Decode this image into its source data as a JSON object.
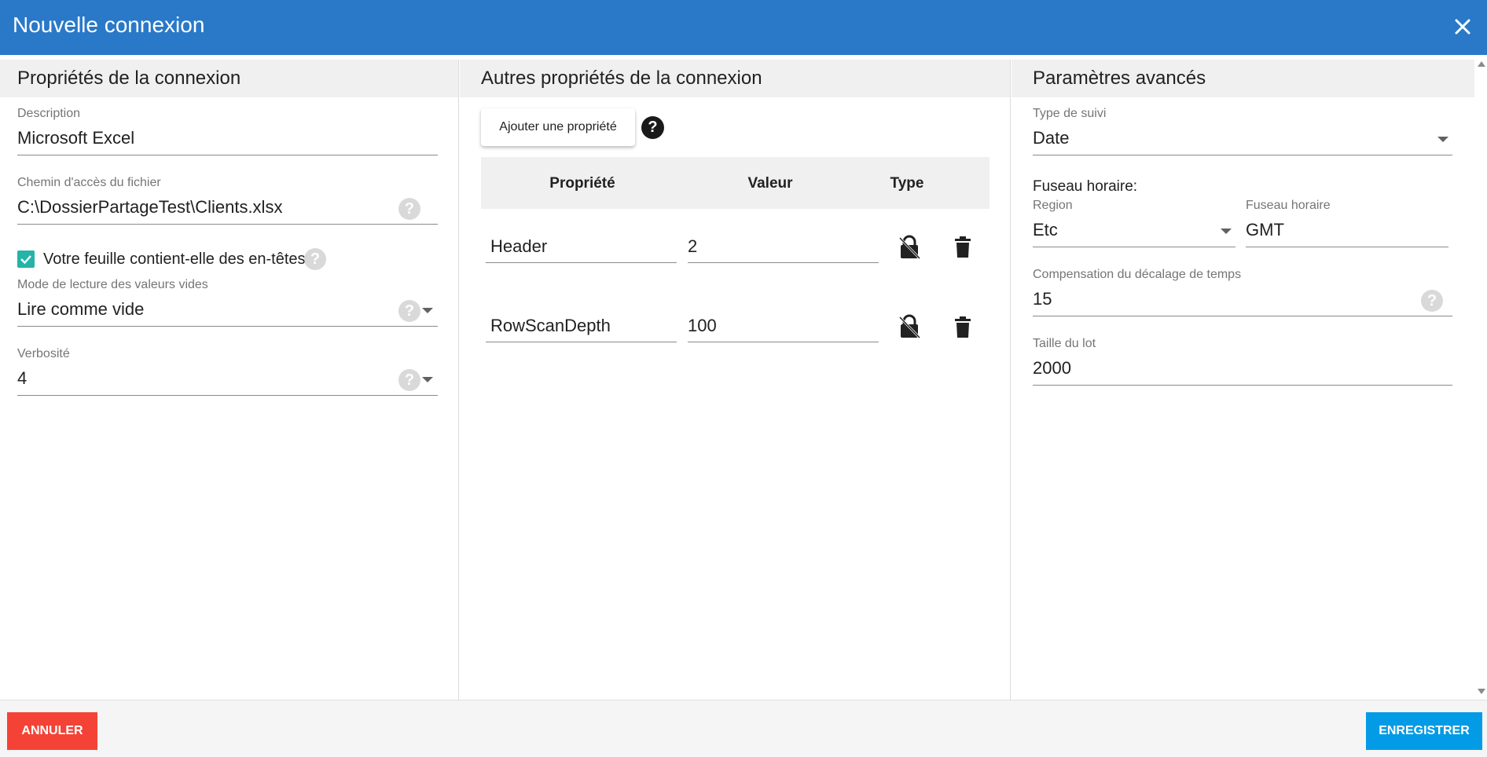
{
  "dialog": {
    "title": "Nouvelle connexion",
    "close_icon": "close-icon"
  },
  "connection_props": {
    "header": "Propriétés de la connexion",
    "description": {
      "label": "Description",
      "value": "Microsoft Excel"
    },
    "file_path": {
      "label": "Chemin d'accès du fichier",
      "value": "C:\\DossierPartageTest\\Clients.xlsx"
    },
    "has_headers": {
      "label": "Votre feuille contient-elle des en-têtes ?",
      "checked": true
    },
    "empty_mode": {
      "label": "Mode de lecture des valeurs vides",
      "value": "Lire comme vide"
    },
    "verbosity": {
      "label": "Verbosité",
      "value": "4"
    }
  },
  "other_props": {
    "header": "Autres propriétés de la connexion",
    "add_button": "Ajouter une propriété",
    "columns": [
      "Propriété",
      "Valeur",
      "Type"
    ],
    "rows": [
      {
        "property": "Header",
        "value": "2"
      },
      {
        "property": "RowScanDepth",
        "value": "100"
      }
    ]
  },
  "advanced": {
    "header": "Paramètres avancés",
    "tracking_type": {
      "label": "Type de suivi",
      "value": "Date"
    },
    "timezone_title": "Fuseau horaire:",
    "region": {
      "label": "Region",
      "value": "Etc"
    },
    "timezone": {
      "label": "Fuseau horaire",
      "value": "GMT"
    },
    "time_offset": {
      "label": "Compensation du décalage de temps",
      "value": "15"
    },
    "batch_size": {
      "label": "Taille du lot",
      "value": "2000"
    }
  },
  "footer": {
    "cancel_label": "ANNULER",
    "save_label": "ENREGISTRER"
  },
  "colors": {
    "titlebar": "#2979c8",
    "cancel": "#f44336",
    "save": "#039be5",
    "checkbox": "#26b3a8"
  }
}
